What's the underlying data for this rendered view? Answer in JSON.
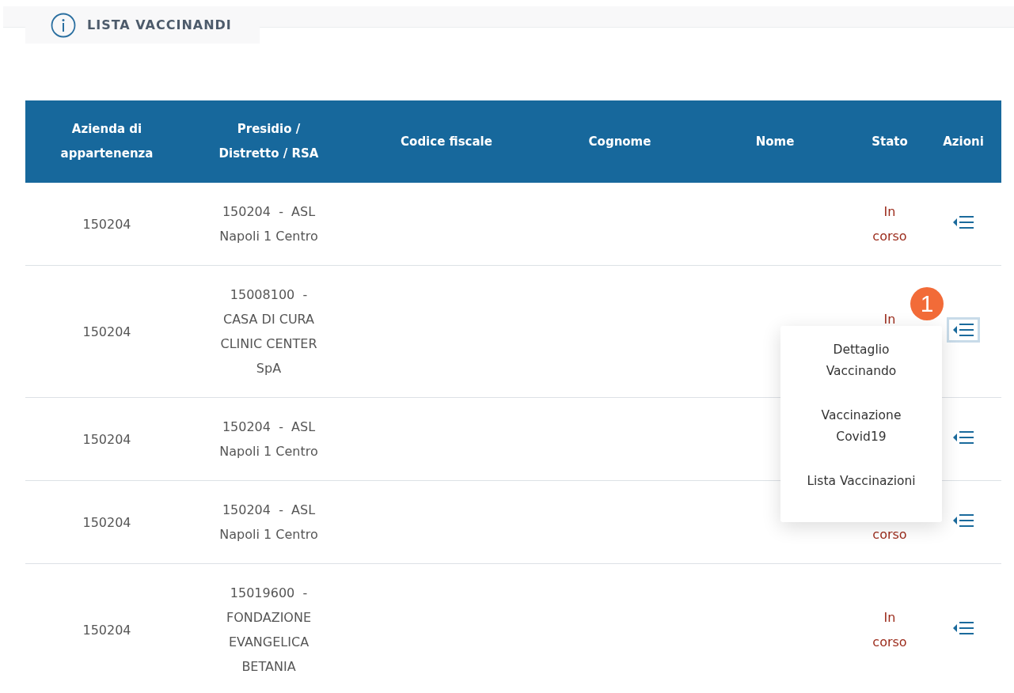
{
  "section": {
    "title": "LISTA VACCINANDI"
  },
  "table": {
    "columns": [
      "Azienda di appartenenza",
      "Presidio / Distretto / RSA",
      "Codice fiscale",
      "Cognome",
      "Nome",
      "Stato",
      "Azioni"
    ],
    "rows": [
      {
        "azienda": "150204",
        "presidio": "150204  -  ASL Napoli 1 Centro",
        "status": {
          "line_1": "In",
          "line_2": "corso"
        },
        "selected": false
      },
      {
        "azienda": "150204",
        "presidio": "15008100  -  CASA DI CURA CLINIC CENTER SpA",
        "status": {
          "line_1": "In"
        },
        "selected": true
      },
      {
        "azienda": "150204",
        "presidio": "150204  -  ASL Napoli 1 Centro",
        "selected": false
      },
      {
        "azienda": "150204",
        "presidio": "150204  -  ASL Napoli 1 Centro",
        "status": {
          "line_2": "corso"
        },
        "selected": false
      },
      {
        "azienda": "150204",
        "presidio": "15019600  -  FONDAZIONE EVANGELICA BETANIA",
        "status": {
          "line_1": "In",
          "line_2": "corso"
        },
        "selected": false
      }
    ]
  },
  "menu": {
    "items": [
      "Dettaglio Vaccinando",
      "Vaccinazione Covid19",
      "Lista Vaccinazioni"
    ]
  },
  "callout": "1"
}
